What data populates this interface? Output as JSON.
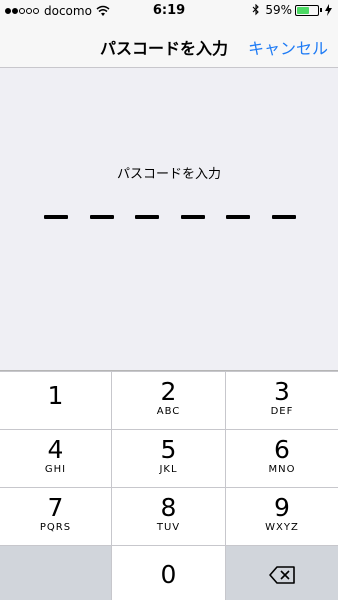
{
  "status_bar": {
    "carrier": "docomo",
    "time": "6:19",
    "battery_percent": "59%",
    "signal_bars_filled": 2,
    "signal_bars_total": 5,
    "battery_level": 0.59,
    "battery_color": "#4cd964",
    "icons": [
      "wifi-icon",
      "bluetooth-icon",
      "battery-icon",
      "charging-icon"
    ]
  },
  "nav": {
    "title": "パスコードを入力",
    "cancel_label": "キャンセル",
    "accent_color": "#1e7bf5"
  },
  "passcode": {
    "prompt": "パスコードを入力",
    "digit_count": 6,
    "entered_count": 0
  },
  "keypad": {
    "keys": [
      {
        "digit": "1",
        "letters": ""
      },
      {
        "digit": "2",
        "letters": "ABC"
      },
      {
        "digit": "3",
        "letters": "DEF"
      },
      {
        "digit": "4",
        "letters": "GHI"
      },
      {
        "digit": "5",
        "letters": "JKL"
      },
      {
        "digit": "6",
        "letters": "MNO"
      },
      {
        "digit": "7",
        "letters": "PQRS"
      },
      {
        "digit": "8",
        "letters": "TUV"
      },
      {
        "digit": "9",
        "letters": "WXYZ"
      },
      {
        "digit": "0",
        "letters": ""
      }
    ],
    "delete_icon": "delete-backspace-icon"
  }
}
